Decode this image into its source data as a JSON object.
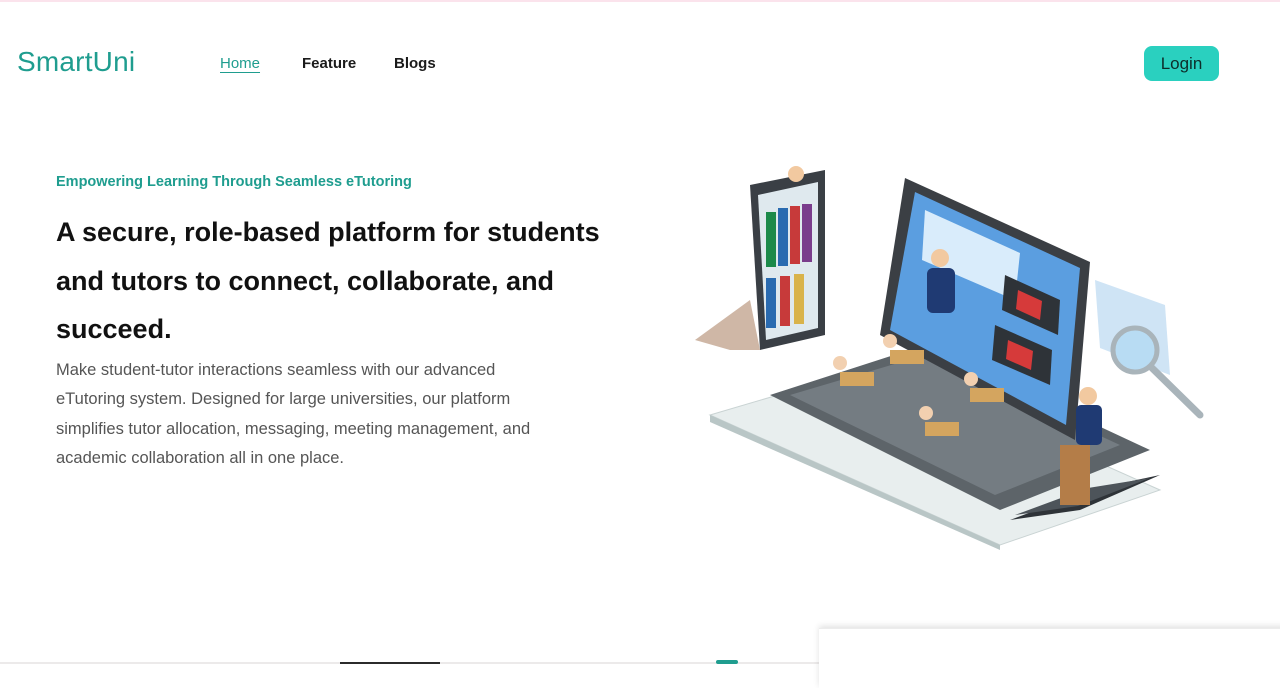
{
  "brand": {
    "name": "SmartUni"
  },
  "nav": {
    "items": [
      {
        "label": "Home"
      },
      {
        "label": "Feature"
      },
      {
        "label": "Blogs"
      }
    ]
  },
  "login": {
    "label": "Login"
  },
  "hero": {
    "tagline": "Empowering Learning Through Seamless eTutoring",
    "headline": "A secure, role-based platform for students and tutors to connect, collaborate, and succeed.",
    "description": "Make student-tutor interactions seamless with our advanced eTutoring system. Designed for large universities, our platform simplifies tutor allocation, messaging, meeting management, and academic collaboration all in one place."
  },
  "colors": {
    "brand": "#1f9d8f",
    "button": "#2ad0bf"
  },
  "illustration": {
    "icon": "etutoring-laptop-illustration"
  }
}
